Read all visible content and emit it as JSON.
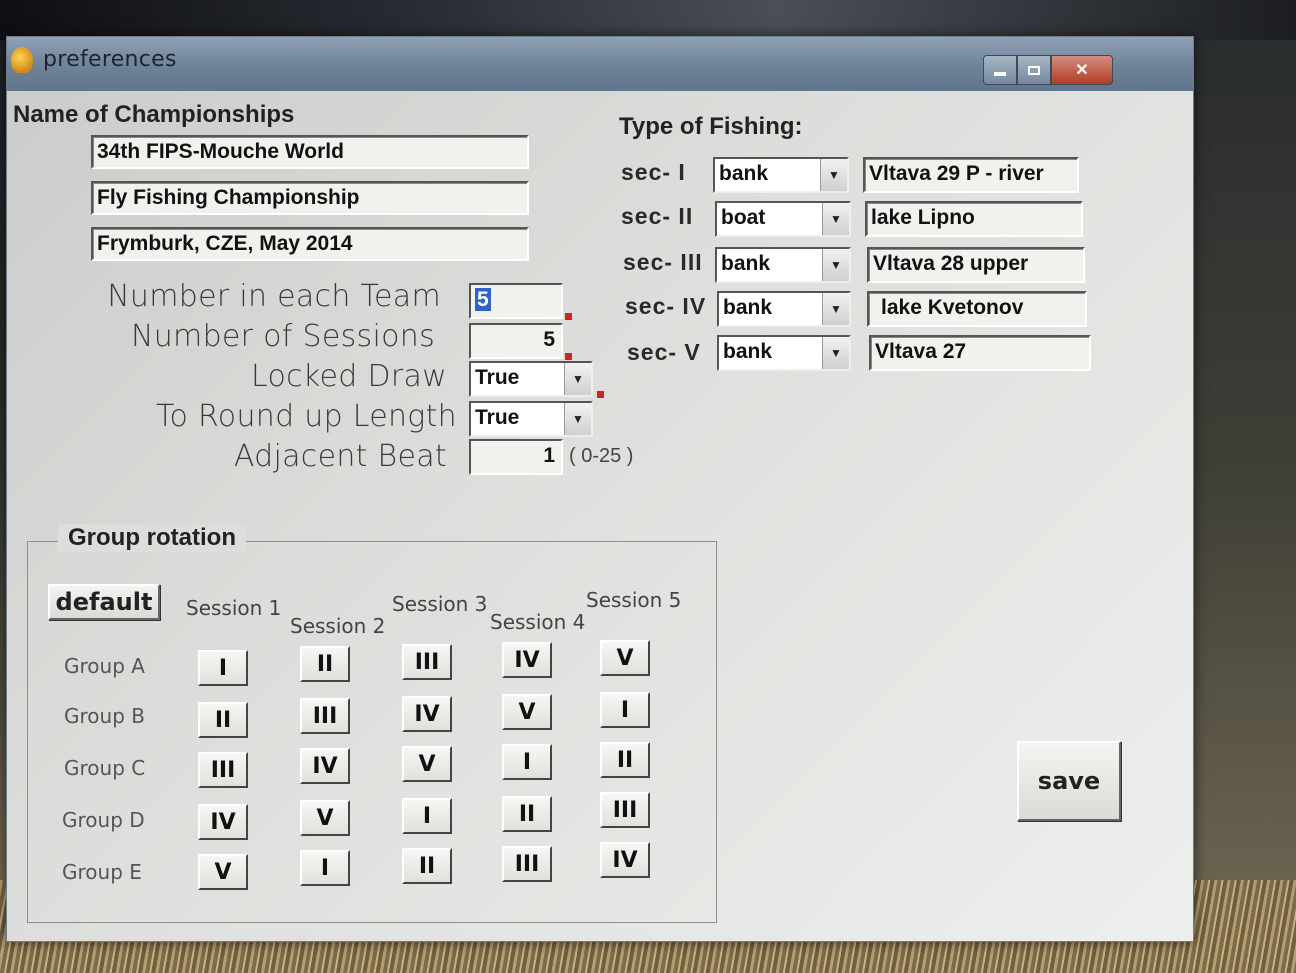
{
  "window": {
    "title": "preferences"
  },
  "championship": {
    "heading": "Name of Championships",
    "line1": "34th FIPS-Mouche World",
    "line2": "Fly Fishing Championship",
    "line3": "Frymburk, CZE, May 2014"
  },
  "settings": {
    "team_label": "Number in each Team",
    "team_value": "5",
    "sessions_label": "Number of Sessions",
    "sessions_value": "5",
    "locked_label": "Locked Draw",
    "locked_value": "True",
    "roundup_label": "To Round up Length",
    "roundup_value": "True",
    "adjacent_label": "Adjacent Beat",
    "adjacent_value": "1",
    "adjacent_hint": "( 0-25 )"
  },
  "fishing": {
    "heading": "Type of Fishing:",
    "sectors": [
      {
        "label": "sec- I",
        "type": "bank",
        "venue": "Vltava 29 P - river"
      },
      {
        "label": "sec- II",
        "type": "boat",
        "venue": "lake Lipno"
      },
      {
        "label": "sec- III",
        "type": "bank",
        "venue": "Vltava 28 upper"
      },
      {
        "label": "sec- IV",
        "type": "bank",
        "venue": "lake Kvetonov"
      },
      {
        "label": "sec- V",
        "type": "bank",
        "venue": "Vltava 27"
      }
    ]
  },
  "rotation": {
    "title": "Group rotation",
    "default_label": "default",
    "sessions": [
      "Session 1",
      "Session 2",
      "Session 3",
      "Session 4",
      "Session 5"
    ],
    "groups": [
      {
        "name": "Group A",
        "cells": [
          "I",
          "II",
          "III",
          "IV",
          "V"
        ]
      },
      {
        "name": "Group B",
        "cells": [
          "II",
          "III",
          "IV",
          "V",
          "I"
        ]
      },
      {
        "name": "Group C",
        "cells": [
          "III",
          "IV",
          "V",
          "I",
          "II"
        ]
      },
      {
        "name": "Group D",
        "cells": [
          "IV",
          "V",
          "I",
          "II",
          "III"
        ]
      },
      {
        "name": "Group E",
        "cells": [
          "V",
          "I",
          "II",
          "III",
          "IV"
        ]
      }
    ]
  },
  "actions": {
    "save_label": "save"
  }
}
